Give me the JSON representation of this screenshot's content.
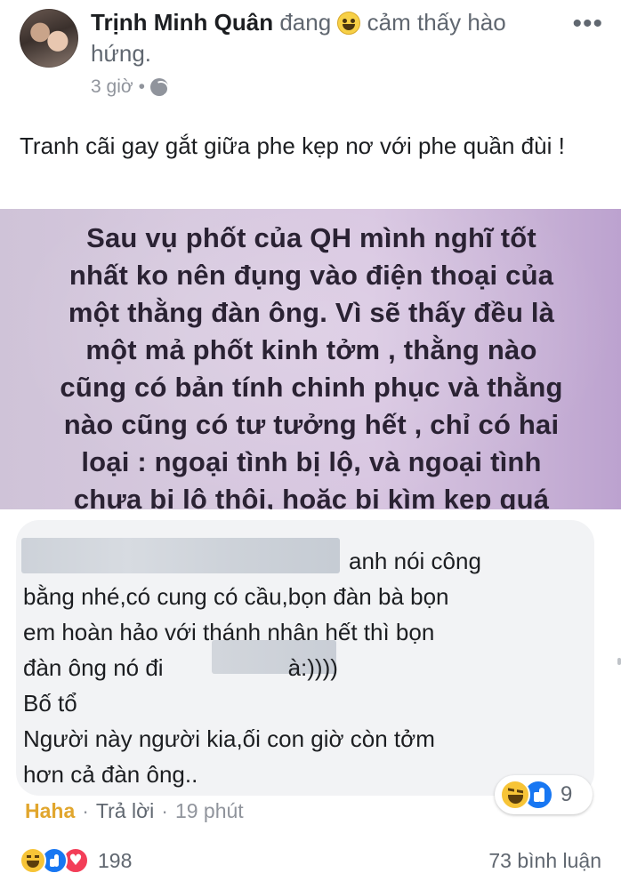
{
  "post": {
    "author": "Trịnh Minh Quân",
    "feeling_prefix": "đang",
    "feeling_text": "cảm thấy hào hứng.",
    "time": "3 giờ",
    "privacy_icon": "globe-icon",
    "more_icon": "more-options-icon",
    "text": "Tranh cãi gay gắt giữa phe kẹp nơ với phe quần đùi !"
  },
  "image": {
    "background_color": "#d6c8de",
    "lines": [
      "Sau vụ phốt của QH mình nghĩ tốt",
      "nhất ko nên đụng vào điện thoại của",
      "một thằng đàn ông. Vì sẽ thấy đều là",
      "một mả phốt kinh tởm , thằng nào",
      "cũng có bản tính chinh phục và thằng",
      "nào cũng có tư tưởng hết , chỉ có hai",
      "loại : ngoại tình bị lộ, và ngoại tình",
      "chưa bị lộ thôi, hoặc bị kìm kẹp quá"
    ]
  },
  "comment": {
    "line1": "anh nói công",
    "line2": "bằng nhé,có cung có cầu,bọn đàn bà bọn",
    "line3": "em hoàn hảo với thánh nhân hết thì bọn",
    "line4_start": "đàn ông nó đi",
    "line4_end": "à:))))",
    "line5": "Bố tổ",
    "line6": "Người này người kia,ối con giờ còn tởm",
    "line7": "hơn cả đàn ông..",
    "reaction_count": "9",
    "action_haha": "Haha",
    "action_reply": "Trả lời",
    "time": "19 phút"
  },
  "footer": {
    "reaction_count": "198",
    "comment_count": "73 bình luận"
  }
}
